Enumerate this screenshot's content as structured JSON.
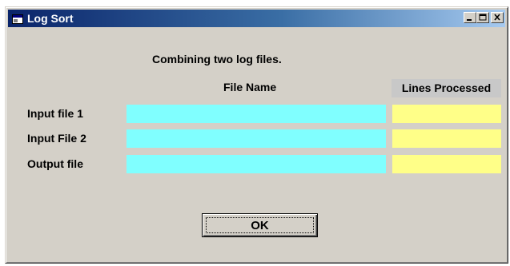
{
  "window": {
    "title": "Log Sort",
    "icon": "app-window-icon",
    "controls": [
      "minimize-icon",
      "maximize-icon",
      "close-icon"
    ]
  },
  "form": {
    "heading": "Combining two log files.",
    "columns": {
      "file_name": "File Name",
      "lines_processed": "Lines Processed"
    },
    "rows": [
      {
        "label": "Input file 1",
        "file_name": "",
        "lines_processed": ""
      },
      {
        "label": "Input File 2",
        "file_name": "",
        "lines_processed": ""
      },
      {
        "label": "Output file",
        "file_name": "",
        "lines_processed": ""
      }
    ],
    "ok_label": "OK"
  },
  "colors": {
    "title_bar": "#0a246a",
    "file_name_field": "#80ffff",
    "lines_field": "#ffff88",
    "dialog_face": "#d4d0c8"
  }
}
